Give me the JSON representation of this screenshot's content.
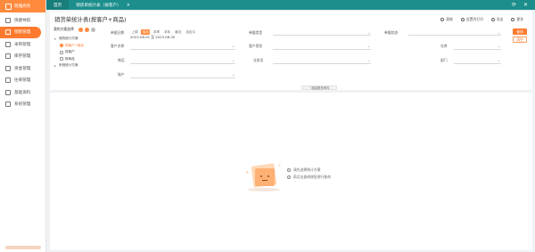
{
  "sidebar": {
    "logo_text": "晓雅商务",
    "items": [
      {
        "label": "快捷导航",
        "icon": "home-icon",
        "active": false
      },
      {
        "label": "销售管理",
        "icon": "sales-icon",
        "active": true
      },
      {
        "label": "采购管理",
        "icon": "cart-icon",
        "active": false
      },
      {
        "label": "库存管理",
        "icon": "box-icon",
        "active": false
      },
      {
        "label": "资金管理",
        "icon": "wallet-icon",
        "active": false
      },
      {
        "label": "往来管理",
        "icon": "users-icon",
        "active": false
      },
      {
        "label": "基础资料",
        "icon": "database-icon",
        "active": false
      },
      {
        "label": "系统管理",
        "icon": "gear-icon",
        "active": false
      }
    ]
  },
  "topbar": {
    "home_tab": "首页",
    "current_tab": "销货单统计表（按客户）",
    "close": "×"
  },
  "page": {
    "title": "销货单统计表(按客户+商品)",
    "tools": [
      "表格",
      "设置列打印",
      "导出",
      "更多"
    ]
  },
  "scheme": {
    "title": "我的方案选择",
    "tree": [
      {
        "label": "我的统计方案",
        "level": 1,
        "selected": false
      },
      {
        "label": "按客户+商品",
        "level": 2,
        "selected": true
      },
      {
        "label": "按客户",
        "level": 2,
        "selected": false
      },
      {
        "label": "按商品",
        "level": 2,
        "selected": false
      },
      {
        "label": "系统统计方案",
        "level": 1,
        "selected": false
      }
    ]
  },
  "filters": {
    "date_label": "单据日期",
    "date_chips": [
      {
        "label": "上周",
        "on": false
      },
      {
        "label": "本月",
        "on": true
      },
      {
        "label": "本季",
        "on": false
      },
      {
        "label": "本年",
        "on": false
      },
      {
        "label": "最近",
        "on": false
      },
      {
        "label": "自定义",
        "on": false
      }
    ],
    "date_range": "2023-06-01 至 2023-06-30",
    "doc_type_label": "单据类型",
    "doc_status_label": "单据状态",
    "customer_label": "客户名称",
    "customer_cat_label": "客户类别",
    "warehouse_label": "仓库",
    "product_label": "商品",
    "salesman_label": "业务员",
    "dept_label": "部门",
    "account_label": "账户",
    "query_button": "查询",
    "reset_button": "清空",
    "collapse_text": "收起更多条件"
  },
  "empty": {
    "tips": [
      "请先选择统计方案",
      "再点击查询按钮进行查询"
    ]
  }
}
